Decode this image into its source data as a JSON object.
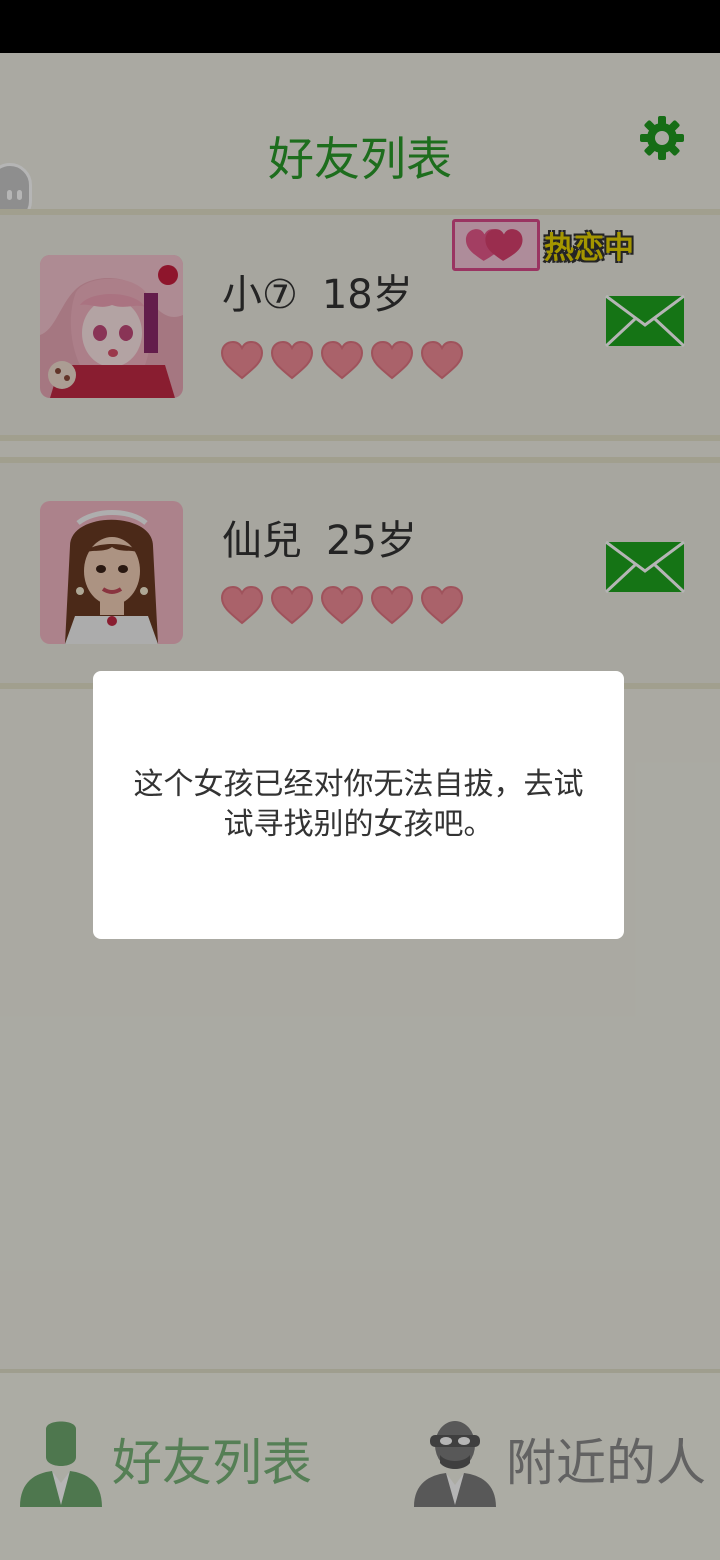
{
  "header": {
    "title": "好友列表",
    "settings_icon": "gear-icon"
  },
  "friends": [
    {
      "name": "小⑦",
      "age": "18岁",
      "hearts": 5,
      "status": "热恋中",
      "avatar": "avatar-pink-anime-girl"
    },
    {
      "name": "仙兒",
      "age": "25岁",
      "hearts": 5,
      "avatar": "avatar-brown-hair-girl"
    }
  ],
  "dialog": {
    "message": "这个女孩已经对你无法自拔，去试试寻找别的女孩吧。"
  },
  "bottom_nav": {
    "tabs": [
      {
        "label": "好友列表",
        "icon": "person-icon",
        "active": true
      },
      {
        "label": "附近的人",
        "icon": "masked-person-icon",
        "active": false
      }
    ]
  },
  "colors": {
    "accent": "#2a9a2a",
    "heart": "#f08a96",
    "mail": "#1ea41e",
    "badge_text": "#e8d400"
  }
}
